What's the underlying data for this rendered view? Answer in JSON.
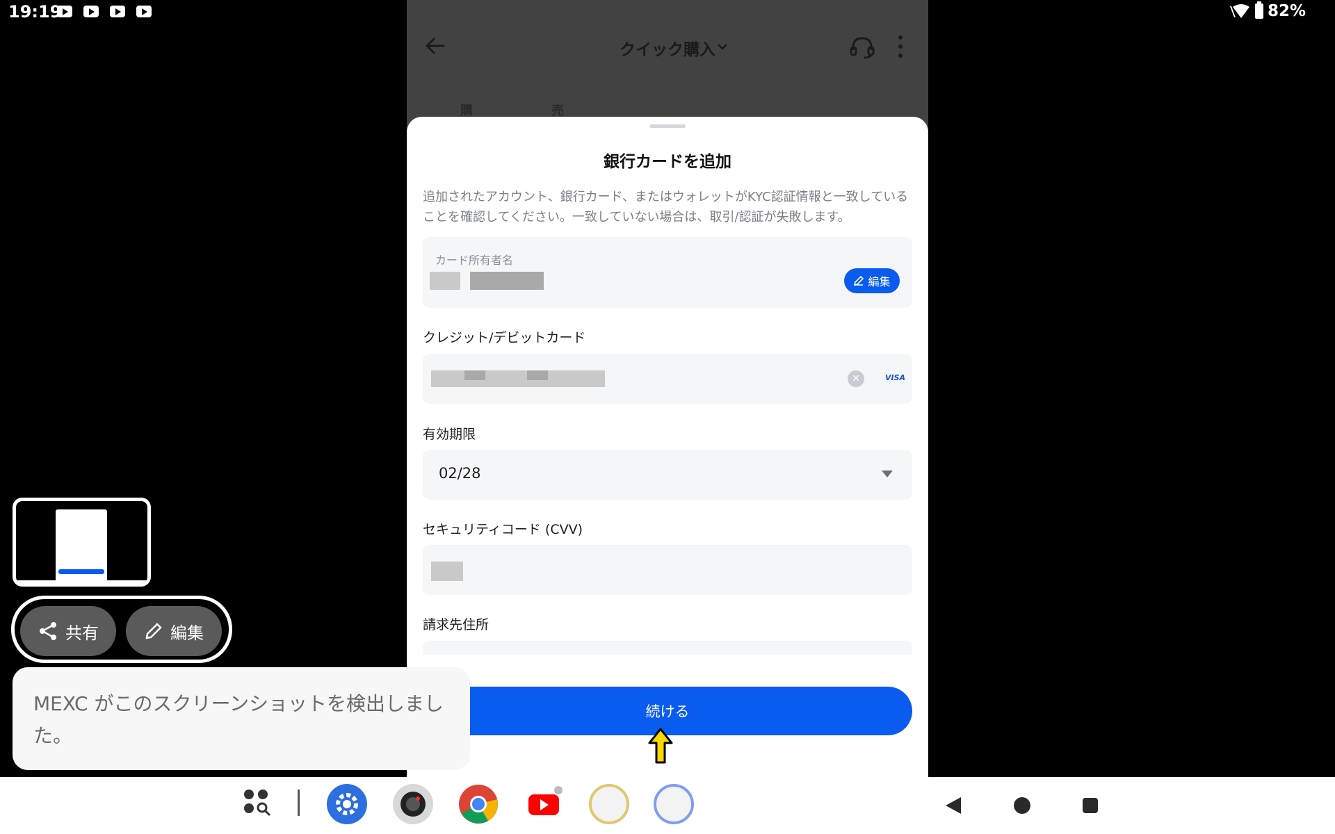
{
  "status_bar": {
    "time": "19:19",
    "battery": "82%"
  },
  "app": {
    "header_title": "クイック購入",
    "tabs": [
      "購入",
      "売却"
    ]
  },
  "sheet": {
    "title": "銀行カードを追加",
    "notice": "追加されたアカウント、銀行カード、またはウォレットがKYC認証情報と一致していることを確認してください。一致していない場合は、取引/認証が失敗します。",
    "card_holder": {
      "label": "カード所有者名",
      "edit_label": "編集"
    },
    "card_number": {
      "label": "クレジット/デビットカード",
      "brand": "VISA"
    },
    "expiry": {
      "label": "有効期限",
      "value": "02/28"
    },
    "cvv": {
      "label": "セキュリティコード (CVV)"
    },
    "billing": {
      "label": "請求先住所"
    },
    "continue_label": "続ける"
  },
  "annotation": {
    "label": "クリック"
  },
  "screenshot_overlay": {
    "share_label": "共有",
    "edit_label": "編集",
    "toast": "MEXC がこのスクリーンショットを検出しました。"
  },
  "colors": {
    "accent": "#0a5bf0",
    "annotation": "#f7d900"
  }
}
